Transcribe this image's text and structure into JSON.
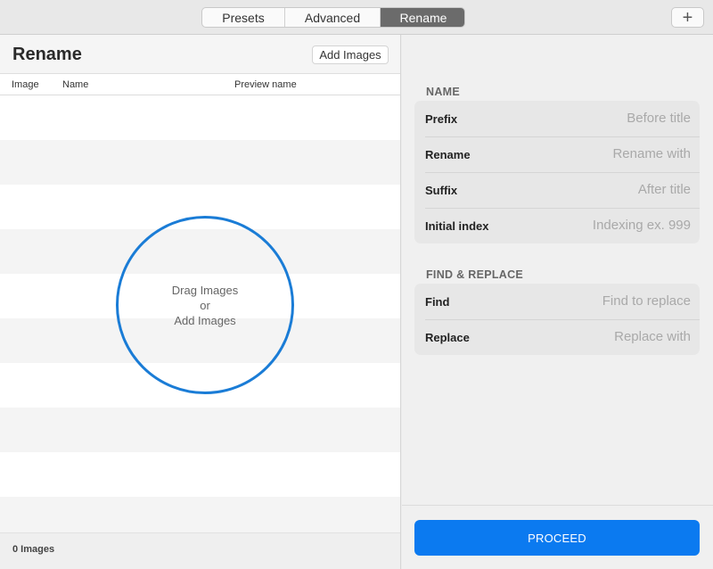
{
  "toolbar": {
    "tabs": [
      {
        "label": "Presets",
        "active": false
      },
      {
        "label": "Advanced",
        "active": false
      },
      {
        "label": "Rename",
        "active": true
      }
    ],
    "add_icon": "plus-icon",
    "add_symbol": "+"
  },
  "left": {
    "title": "Rename",
    "add_images_label": "Add Images",
    "columns": [
      "Image",
      "Name",
      "Preview name"
    ],
    "drop_zone": {
      "line1": "Drag Images",
      "line2": "or",
      "line3": "Add Images"
    },
    "footer_count": "0 Images"
  },
  "right": {
    "name_section": {
      "title": "NAME",
      "fields": [
        {
          "label": "Prefix",
          "placeholder": "Before title",
          "value": ""
        },
        {
          "label": "Rename",
          "placeholder": "Rename with",
          "value": ""
        },
        {
          "label": "Suffix",
          "placeholder": "After title",
          "value": ""
        },
        {
          "label": "Initial index",
          "placeholder": "Indexing ex. 999",
          "value": ""
        }
      ]
    },
    "replace_section": {
      "title": "FIND & REPLACE",
      "fields": [
        {
          "label": "Find",
          "placeholder": "Find to replace",
          "value": ""
        },
        {
          "label": "Replace",
          "placeholder": "Replace with",
          "value": ""
        }
      ]
    },
    "proceed_label": "PROCEED"
  },
  "colors": {
    "accent": "#0b7af0",
    "drop_ring": "#1a7cd6",
    "active_tab": "#6b6b6b"
  }
}
